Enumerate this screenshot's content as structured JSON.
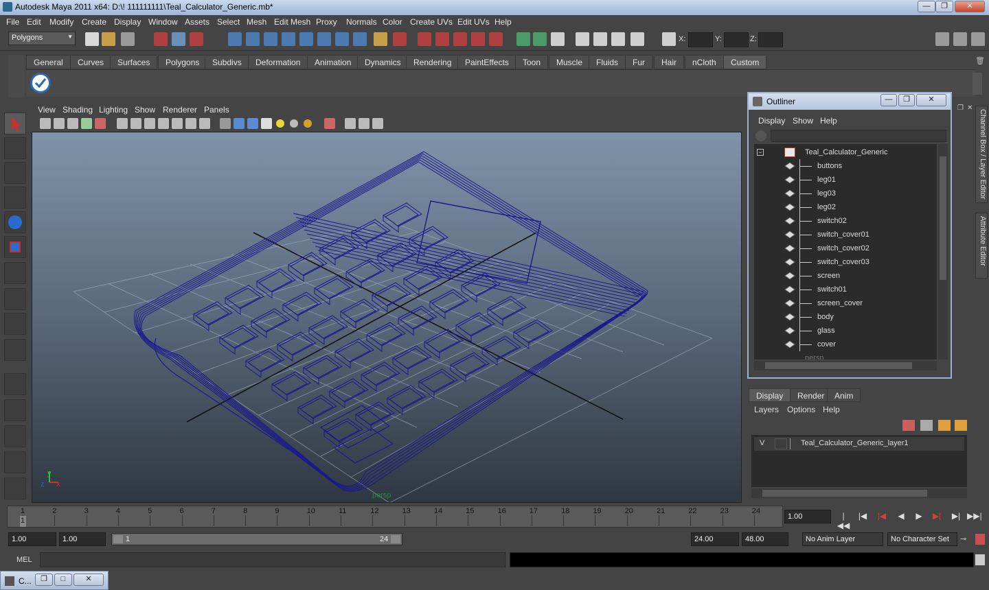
{
  "window": {
    "title": "Autodesk Maya 2011 x64: D:\\! 111111111\\Teal_Calculator_Generic.mb*"
  },
  "menubar": [
    "File",
    "Edit",
    "Modify",
    "Create",
    "Display",
    "Window",
    "Assets",
    "Select",
    "Mesh",
    "Edit Mesh",
    "Proxy",
    "Normals",
    "Color",
    "Create UVs",
    "Edit UVs",
    "Help"
  ],
  "statusline": {
    "mode": "Polygons",
    "x_label": "X:",
    "y_label": "Y:",
    "z_label": "Z:"
  },
  "shelf": {
    "tabs": [
      "General",
      "Curves",
      "Surfaces",
      "Polygons",
      "Subdivs",
      "Deformation",
      "Animation",
      "Dynamics",
      "Rendering",
      "PaintEffects",
      "Toon",
      "Muscle",
      "Fluids",
      "Fur",
      "Hair",
      "nCloth",
      "Custom"
    ],
    "active_tab": "Custom"
  },
  "viewport": {
    "menu": [
      "View",
      "Shading",
      "Lighting",
      "Show",
      "Renderer",
      "Panels"
    ],
    "camera_label": "persp",
    "axis_y": "y",
    "axis_z": "z",
    "axis_x": "x",
    "wire_color": "#1a1a8c"
  },
  "outliner": {
    "title": "Outliner",
    "menu": [
      "Display",
      "Show",
      "Help"
    ],
    "root": "Teal_Calculator_Generic",
    "children": [
      "buttons",
      "leg01",
      "leg03",
      "leg02",
      "switch02",
      "switch_cover01",
      "switch_cover02",
      "switch_cover03",
      "screen",
      "switch01",
      "screen_cover",
      "body",
      "glass",
      "cover"
    ],
    "partial": "persp"
  },
  "sidetabs": [
    "Channel Box / Layer Editor",
    "Attribute Editor"
  ],
  "layer_editor": {
    "tabs": [
      "Display",
      "Render",
      "Anim"
    ],
    "active_tab": "Display",
    "menu": [
      "Layers",
      "Options",
      "Help"
    ],
    "layer_visible": "V",
    "layer_name": "Teal_Calculator_Generic_layer1"
  },
  "timeline": {
    "ticks": [
      "1",
      "2",
      "3",
      "4",
      "5",
      "6",
      "7",
      "8",
      "9",
      "10",
      "11",
      "12",
      "13",
      "14",
      "15",
      "16",
      "17",
      "18",
      "19",
      "20",
      "21",
      "22",
      "23",
      "24"
    ],
    "current_frame_marker": "1",
    "current_time": "1.00"
  },
  "range": {
    "start": "1.00",
    "playback_start": "1.00",
    "slider_start": "1",
    "slider_end": "24",
    "playback_end": "24.00",
    "end": "48.00",
    "anim_layer": "No Anim Layer",
    "character_set": "No Character Set"
  },
  "commandline": {
    "label": "MEL"
  },
  "minimized": {
    "title": "C..."
  }
}
